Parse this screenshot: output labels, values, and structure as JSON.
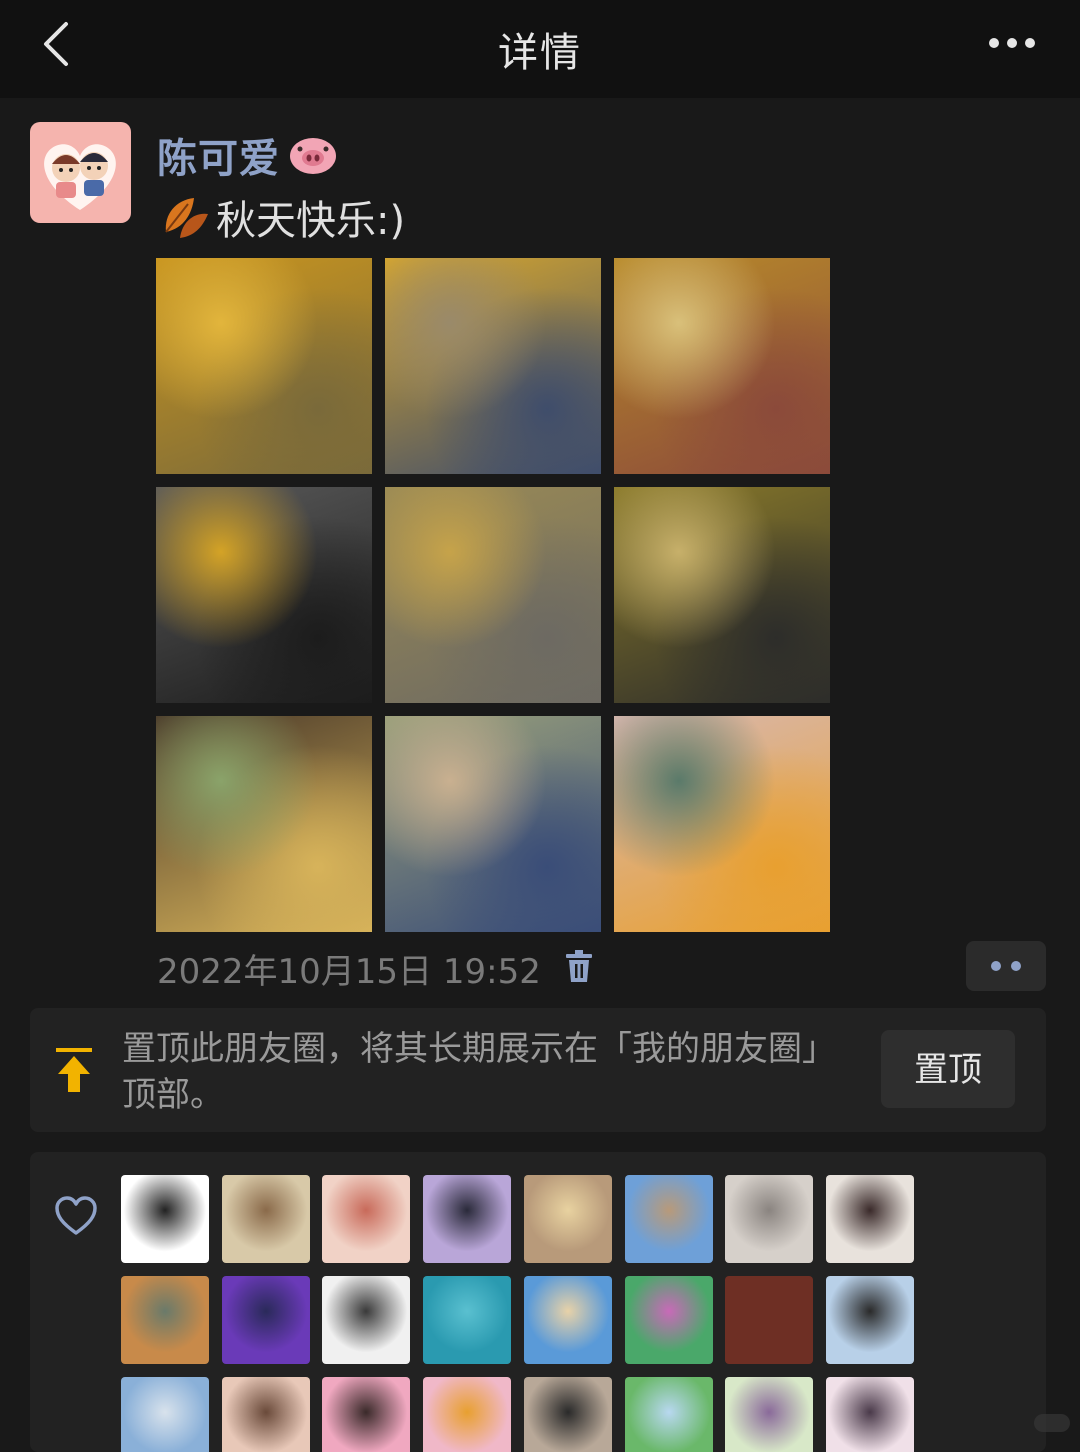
{
  "nav": {
    "title": "详情",
    "back_icon": "chevron-left-icon",
    "more_icon": "more-horizontal-icon"
  },
  "post": {
    "author_name": "陈可爱",
    "name_emoji": "pig-face-emoji",
    "text": "秋天快乐:)",
    "text_emoji": "fallen-leaf-emoji",
    "timestamp": "2022年10月15日 19:52",
    "photos": [
      {
        "name": "photo-yellow-trees-streetlamp",
        "colors": [
          "#c9951f",
          "#7a6a3a",
          "#e2b53c"
        ]
      },
      {
        "name": "photo-girl-under-yellow-trees",
        "colors": [
          "#d6a62e",
          "#3f4d6b",
          "#9a8a6a"
        ]
      },
      {
        "name": "photo-yellow-trees-buildings",
        "colors": [
          "#b88a2a",
          "#8b4a3a",
          "#d9c07a"
        ]
      },
      {
        "name": "photo-bike-basket-leaves",
        "colors": [
          "#5a5a5a",
          "#1c1c1c",
          "#d4a326"
        ]
      },
      {
        "name": "photo-girl-on-road",
        "colors": [
          "#9a8a55",
          "#6d6a62",
          "#c6a34a"
        ]
      },
      {
        "name": "photo-trees-and-cars",
        "colors": [
          "#8a7a2a",
          "#2d2d2a",
          "#c7b06a"
        ]
      },
      {
        "name": "photo-dinner-table",
        "colors": [
          "#4a3a2a",
          "#d7b35a",
          "#8aa36a"
        ]
      },
      {
        "name": "photo-girl-denim-jacket",
        "colors": [
          "#9aa07a",
          "#3a4d78",
          "#c9b090"
        ]
      },
      {
        "name": "photo-fish-slices-soup",
        "colors": [
          "#d8b8b0",
          "#e8a030",
          "#5a7a6a"
        ]
      }
    ]
  },
  "pin_card": {
    "text": "置顶此朋友圈，将其长期展示在「我的朋友圈」顶部。",
    "button_label": "置顶",
    "accent_color": "#f2b300"
  },
  "likes": {
    "heart_icon": "heart-outline-icon",
    "avatars": [
      {
        "name": "like-avatar-line-drawing",
        "colors": [
          "#ffffff",
          "#222222"
        ]
      },
      {
        "name": "like-avatar-angel-girl",
        "colors": [
          "#d8c9a8",
          "#8a6a4a"
        ]
      },
      {
        "name": "like-avatar-girl-pink",
        "colors": [
          "#f1d2c6",
          "#c86a5a"
        ]
      },
      {
        "name": "like-avatar-girl-purple-blazer",
        "colors": [
          "#b9a6d8",
          "#2a2a3a"
        ]
      },
      {
        "name": "like-avatar-blonde-girl-cafe",
        "colors": [
          "#b89a7a",
          "#e8d2a0"
        ]
      },
      {
        "name": "like-avatar-castle-sky",
        "colors": [
          "#6ea0d8",
          "#b89a7a"
        ]
      },
      {
        "name": "like-avatar-white-cat",
        "colors": [
          "#d6d0ca",
          "#8a8480"
        ]
      },
      {
        "name": "like-avatar-girl-rabbit",
        "colors": [
          "#e8e2dc",
          "#3a2a2a"
        ]
      },
      {
        "name": "like-avatar-cats-orange",
        "colors": [
          "#c88a4a",
          "#6a7a6a"
        ]
      },
      {
        "name": "like-avatar-girl-purple-shirt",
        "colors": [
          "#6a3ab8",
          "#2a2a5a"
        ]
      },
      {
        "name": "like-avatar-manga-character",
        "colors": [
          "#f0f0f0",
          "#3a3a3a"
        ]
      },
      {
        "name": "like-avatar-sea-water",
        "colors": [
          "#2a9ab0",
          "#5ac0d0"
        ]
      },
      {
        "name": "like-avatar-girl-beach",
        "colors": [
          "#5a9ad8",
          "#e8d2a8"
        ]
      },
      {
        "name": "like-avatar-powerpuff",
        "colors": [
          "#4aa86a",
          "#c86ab8"
        ]
      },
      {
        "name": "like-avatar-solid-brown",
        "colors": [
          "#6e2f24",
          "#6e2f24"
        ]
      },
      {
        "name": "like-avatar-girl-seaside",
        "colors": [
          "#b8d0e8",
          "#2a2a2a"
        ]
      },
      {
        "name": "like-avatar-sky-clouds",
        "colors": [
          "#8ab0d8",
          "#d8e2ec"
        ]
      },
      {
        "name": "like-avatar-girl-selfie",
        "colors": [
          "#e8c8b8",
          "#6a4a3a"
        ]
      },
      {
        "name": "like-avatar-hearts-cartoon",
        "colors": [
          "#f0a8c0",
          "#3a2a2a"
        ]
      },
      {
        "name": "like-avatar-cartoon-girl",
        "colors": [
          "#f0b8c8",
          "#e8a030"
        ]
      },
      {
        "name": "like-avatar-funny-face",
        "colors": [
          "#b8a898",
          "#2a2a2a"
        ]
      },
      {
        "name": "like-avatar-field-landscape",
        "colors": [
          "#6ab86a",
          "#b8d8f0"
        ]
      },
      {
        "name": "like-avatar-cartoon-animal",
        "colors": [
          "#d8e8c8",
          "#8a6a9a"
        ]
      },
      {
        "name": "like-avatar-anime-girl",
        "colors": [
          "#f0e0e8",
          "#4a3a4a"
        ]
      }
    ]
  }
}
